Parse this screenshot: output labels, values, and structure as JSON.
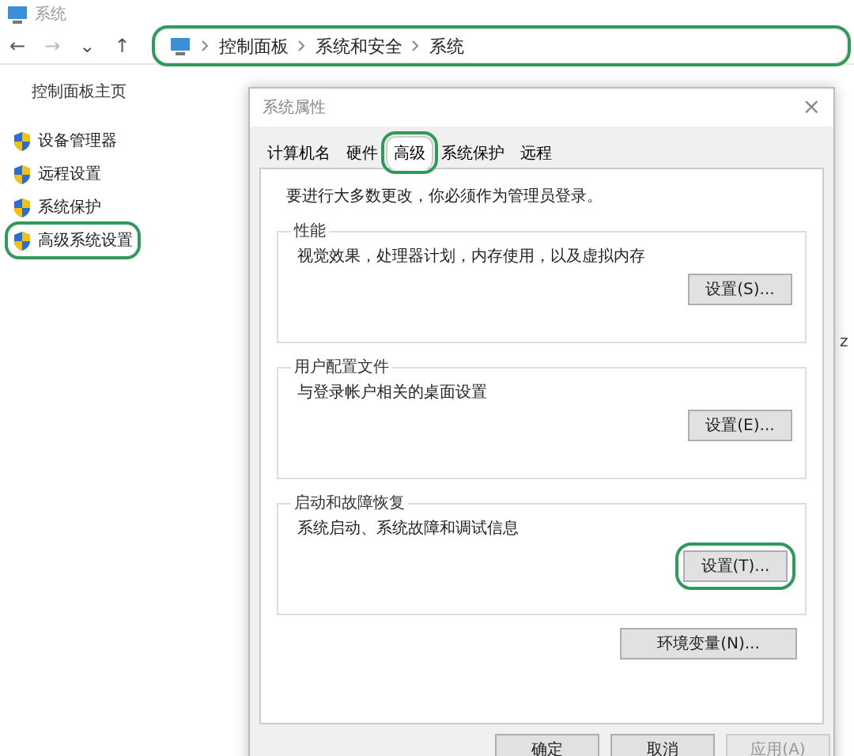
{
  "window": {
    "title": "系统"
  },
  "nav": {
    "buttons": [
      "←",
      "→",
      "⌄",
      "↑"
    ]
  },
  "address_bar": {
    "highlighted": true,
    "crumbs": [
      "控制面板",
      "系统和安全",
      "系统"
    ]
  },
  "sidebar": {
    "home": "控制面板主页",
    "items": [
      {
        "label": "设备管理器",
        "highlighted": false
      },
      {
        "label": "远程设置",
        "highlighted": false
      },
      {
        "label": "系统保护",
        "highlighted": false
      },
      {
        "label": "高级系统设置",
        "highlighted": true
      }
    ]
  },
  "background_text": "z",
  "dialog": {
    "title": "系统属性",
    "close": "×",
    "tabs": [
      {
        "label": "计算机名",
        "selected": false,
        "highlighted": false
      },
      {
        "label": "硬件",
        "selected": false,
        "highlighted": false
      },
      {
        "label": "高级",
        "selected": true,
        "highlighted": true
      },
      {
        "label": "系统保护",
        "selected": false,
        "highlighted": false
      },
      {
        "label": "远程",
        "selected": false,
        "highlighted": false
      }
    ],
    "notice": "要进行大多数更改，你必须作为管理员登录。",
    "groups": [
      {
        "title": "性能",
        "description": "视觉效果，处理器计划，内存使用，以及虚拟内存",
        "button": "设置(S)...",
        "highlighted": false
      },
      {
        "title": "用户配置文件",
        "description": "与登录帐户相关的桌面设置",
        "button": "设置(E)...",
        "highlighted": false
      },
      {
        "title": "启动和故障恢复",
        "description": "系统启动、系统故障和调试信息",
        "button": "设置(T)...",
        "highlighted": true
      }
    ],
    "env_button": "环境变量(N)...",
    "footer": [
      {
        "label": "确定",
        "disabled": false
      },
      {
        "label": "取消",
        "disabled": false
      },
      {
        "label": "应用(A)",
        "disabled": true
      }
    ]
  }
}
